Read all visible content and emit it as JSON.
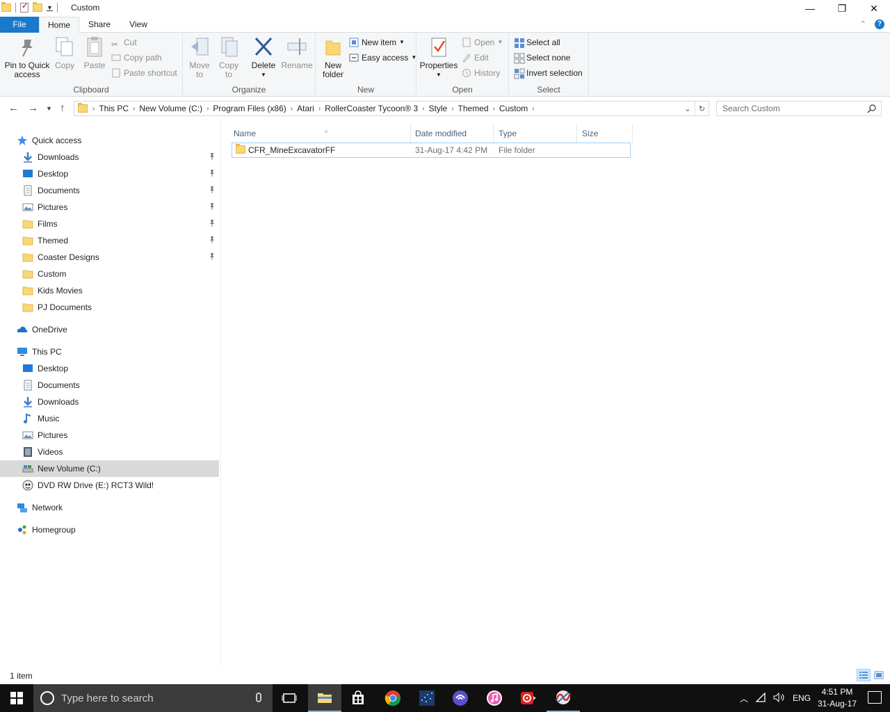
{
  "window": {
    "title": "Custom",
    "controls": {
      "minimize": "—",
      "maximize": "❐",
      "close": "✕"
    }
  },
  "ribbon_tabs": {
    "file": "File",
    "home": "Home",
    "share": "Share",
    "view": "View"
  },
  "ribbon": {
    "clipboard": {
      "label": "Clipboard",
      "pin": "Pin to Quick access",
      "pin_l1": "Pin to Quick",
      "pin_l2": "access",
      "copy": "Copy",
      "paste": "Paste",
      "cut": "Cut",
      "copy_path": "Copy path",
      "paste_shortcut": "Paste shortcut"
    },
    "organize": {
      "label": "Organize",
      "move_l1": "Move",
      "move_l2": "to",
      "copy_l1": "Copy",
      "copy_l2": "to",
      "delete": "Delete",
      "rename": "Rename"
    },
    "new": {
      "label": "New",
      "folder_l1": "New",
      "folder_l2": "folder",
      "new_item": "New item",
      "easy_access": "Easy access"
    },
    "open": {
      "label": "Open",
      "properties": "Properties",
      "open": "Open",
      "edit": "Edit",
      "history": "History"
    },
    "select": {
      "label": "Select",
      "select_all": "Select all",
      "select_none": "Select none",
      "invert": "Invert selection"
    }
  },
  "address": {
    "crumbs": [
      "This PC",
      "New Volume (C:)",
      "Program Files (x86)",
      "Atari",
      "RollerCoaster Tycoon® 3",
      "Style",
      "Themed",
      "Custom"
    ],
    "search_placeholder": "Search Custom"
  },
  "nav": {
    "quick_access": "Quick access",
    "quick_items": [
      {
        "label": "Downloads",
        "icon": "download-icon",
        "pinned": true
      },
      {
        "label": "Desktop",
        "icon": "desktop-icon",
        "pinned": true
      },
      {
        "label": "Documents",
        "icon": "documents-icon",
        "pinned": true
      },
      {
        "label": "Pictures",
        "icon": "pictures-icon",
        "pinned": true
      },
      {
        "label": "Films",
        "icon": "folder-icon",
        "pinned": true
      },
      {
        "label": "Themed",
        "icon": "folder-icon",
        "pinned": true
      },
      {
        "label": "Coaster Designs",
        "icon": "folder-icon",
        "pinned": true
      },
      {
        "label": "Custom",
        "icon": "folder-icon",
        "pinned": false
      },
      {
        "label": "Kids Movies",
        "icon": "folder-icon",
        "pinned": false
      },
      {
        "label": "PJ Documents",
        "icon": "folder-icon",
        "pinned": false
      }
    ],
    "onedrive": "OneDrive",
    "this_pc": "This PC",
    "pc_items": [
      {
        "label": "Desktop",
        "icon": "desktop-icon"
      },
      {
        "label": "Documents",
        "icon": "documents-icon"
      },
      {
        "label": "Downloads",
        "icon": "download-icon"
      },
      {
        "label": "Music",
        "icon": "music-icon"
      },
      {
        "label": "Pictures",
        "icon": "pictures-icon"
      },
      {
        "label": "Videos",
        "icon": "videos-icon"
      },
      {
        "label": "New Volume (C:)",
        "icon": "drive-icon",
        "selected": true
      },
      {
        "label": "DVD RW Drive (E:) RCT3 Wild!",
        "icon": "dvd-icon"
      }
    ],
    "network": "Network",
    "homegroup": "Homegroup"
  },
  "file_list": {
    "columns": {
      "name": "Name",
      "date": "Date modified",
      "type": "Type",
      "size": "Size"
    },
    "rows": [
      {
        "name": "CFR_MineExcavatorFF",
        "date": "31-Aug-17 4:42 PM",
        "type": "File folder",
        "size": ""
      }
    ]
  },
  "status": {
    "item_count": "1 item"
  },
  "taskbar": {
    "search_placeholder": "Type here to search",
    "language": "ENG",
    "time": "4:51 PM",
    "date": "31-Aug-17"
  },
  "colors": {
    "accent": "#1979ca",
    "folder": "#f8d775",
    "selection_border": "#99d1ff",
    "nav_selected": "#d9d9d9",
    "taskbar": "#101010"
  }
}
